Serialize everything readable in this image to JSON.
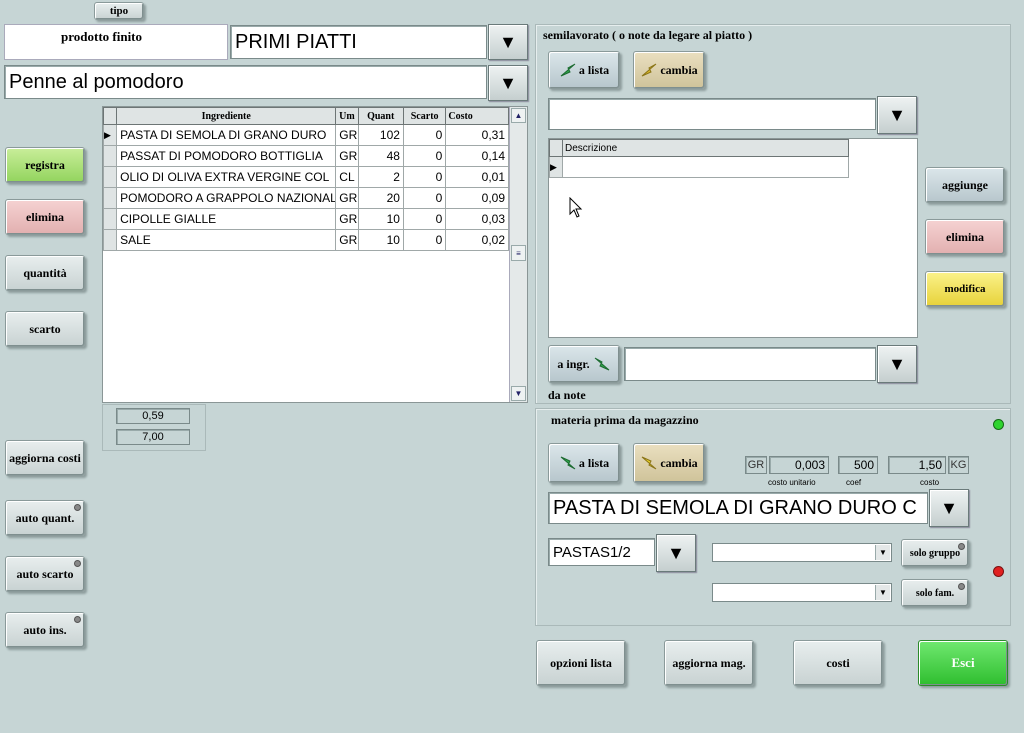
{
  "top": {
    "tipo_label": "tipo",
    "prodotto_finito_label": "prodotto finito",
    "category_value": "PRIMI PIATTI",
    "product_value": "Penne al pomodoro"
  },
  "left_buttons": {
    "registra": "registra",
    "elimina": "elimina",
    "quantita": "quantità",
    "scarto": "scarto",
    "aggiorna_costi": "aggiorna costi",
    "auto_quant": "auto quant.",
    "auto_scarto": "auto scarto",
    "auto_ins": "auto ins."
  },
  "ingredients_table": {
    "columns": [
      "Ingrediente",
      "Um",
      "Quant",
      "Scarto",
      "Costo"
    ],
    "rows": [
      {
        "ingrediente": "PASTA DI SEMOLA DI GRANO DURO",
        "um": "GR",
        "quant": "102",
        "scarto": "0",
        "costo": "0,31"
      },
      {
        "ingrediente": "PASSAT DI POMODORO BOTTIGLIA",
        "um": "GR",
        "quant": "48",
        "scarto": "0",
        "costo": "0,14"
      },
      {
        "ingrediente": "OLIO DI OLIVA EXTRA VERGINE COL",
        "um": "CL",
        "quant": "2",
        "scarto": "0",
        "costo": "0,01"
      },
      {
        "ingrediente": "POMODORO A GRAPPOLO NAZIONALE",
        "um": "GR",
        "quant": "20",
        "scarto": "0",
        "costo": "0,09"
      },
      {
        "ingrediente": "CIPOLLE GIALLE",
        "um": "GR",
        "quant": "10",
        "scarto": "0",
        "costo": "0,03"
      },
      {
        "ingrediente": "SALE",
        "um": "GR",
        "quant": "10",
        "scarto": "0",
        "costo": "0,02"
      }
    ],
    "total_cost": "0,59",
    "total_value": "7,00"
  },
  "semilavorato": {
    "title": "semilavorato ( o note da legare al piatto )",
    "a_lista": "a lista",
    "cambia": "cambia",
    "select_value": "",
    "table_header": "Descrizione",
    "aggiunge": "aggiunge",
    "elimina": "elimina",
    "modifica": "modifica",
    "a_ingr": "a ingr.",
    "a_ingr_value": "",
    "da_note": "da note"
  },
  "materia_prima": {
    "title": "materia prima da magazzino",
    "a_lista": "a lista",
    "cambia": "cambia",
    "um_unit": "GR",
    "costo_unitario": "0,003",
    "costo_unitario_label": "costo unitario",
    "coef": "500",
    "coef_label": "coef",
    "costo": "1,50",
    "costo_label": "costo",
    "um_pack": "KG",
    "product_value": "PASTA DI SEMOLA DI GRANO DURO C",
    "code_value": "PASTAS1/2",
    "gruppo_value": "",
    "fam_value": "",
    "solo_gruppo": "solo gruppo",
    "solo_fam": "solo fam."
  },
  "bottom_buttons": {
    "opzioni_lista": "opzioni lista",
    "aggiorna_mag": "aggiorna mag.",
    "costi": "costi",
    "esci": "Esci"
  },
  "colors": {
    "background": "#c6d5d5",
    "registra": "#a9e07a",
    "esci": "#3fcc3f",
    "modifica": "#f0df4a",
    "indicator_green": "#2fd42f",
    "indicator_red": "#e02020"
  }
}
